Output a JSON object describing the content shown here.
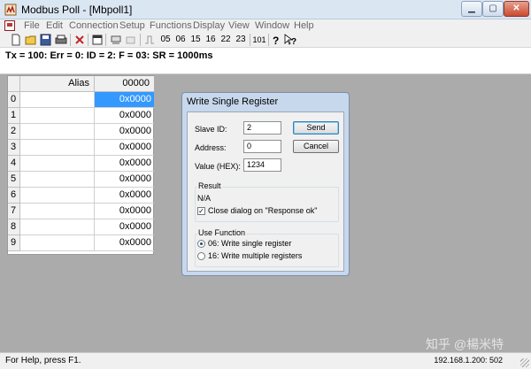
{
  "window": {
    "title": "Modbus Poll - [Mbpoll1]"
  },
  "menu": [
    "File",
    "Edit",
    "Connection",
    "Setup",
    "Functions",
    "Display",
    "View",
    "Window",
    "Help"
  ],
  "toolbar": {
    "function_codes": [
      "05",
      "06",
      "15",
      "16",
      "22",
      "23"
    ],
    "code_101": "101"
  },
  "status_line": "Tx = 100: Err = 0: ID = 2: F = 03: SR = 1000ms",
  "table": {
    "alias_header": "Alias",
    "register_header": "00000",
    "rows": [
      {
        "num": "0",
        "value": "0x0000"
      },
      {
        "num": "1",
        "value": "0x0000"
      },
      {
        "num": "2",
        "value": "0x0000"
      },
      {
        "num": "3",
        "value": "0x0000"
      },
      {
        "num": "4",
        "value": "0x0000"
      },
      {
        "num": "5",
        "value": "0x0000"
      },
      {
        "num": "6",
        "value": "0x0000"
      },
      {
        "num": "7",
        "value": "0x0000"
      },
      {
        "num": "8",
        "value": "0x0000"
      },
      {
        "num": "9",
        "value": "0x0000"
      }
    ]
  },
  "dialog": {
    "title": "Write Single Register",
    "slave_id_label": "Slave ID:",
    "slave_id_value": "2",
    "address_label": "Address:",
    "address_value": "0",
    "value_label": "Value (HEX):",
    "value_value": "1234",
    "send_label": "Send",
    "cancel_label": "Cancel",
    "result_title": "Result",
    "result_text": "N/A",
    "close_dialog_label": "Close dialog on \"Response ok\"",
    "use_function_title": "Use Function",
    "function_06_label": "06: Write single register",
    "function_16_label": "16: Write multiple registers"
  },
  "watermark": "知乎 @楊米特",
  "statusbar": {
    "help": "For Help, press F1.",
    "connection": "192.168.1.200: 502"
  }
}
